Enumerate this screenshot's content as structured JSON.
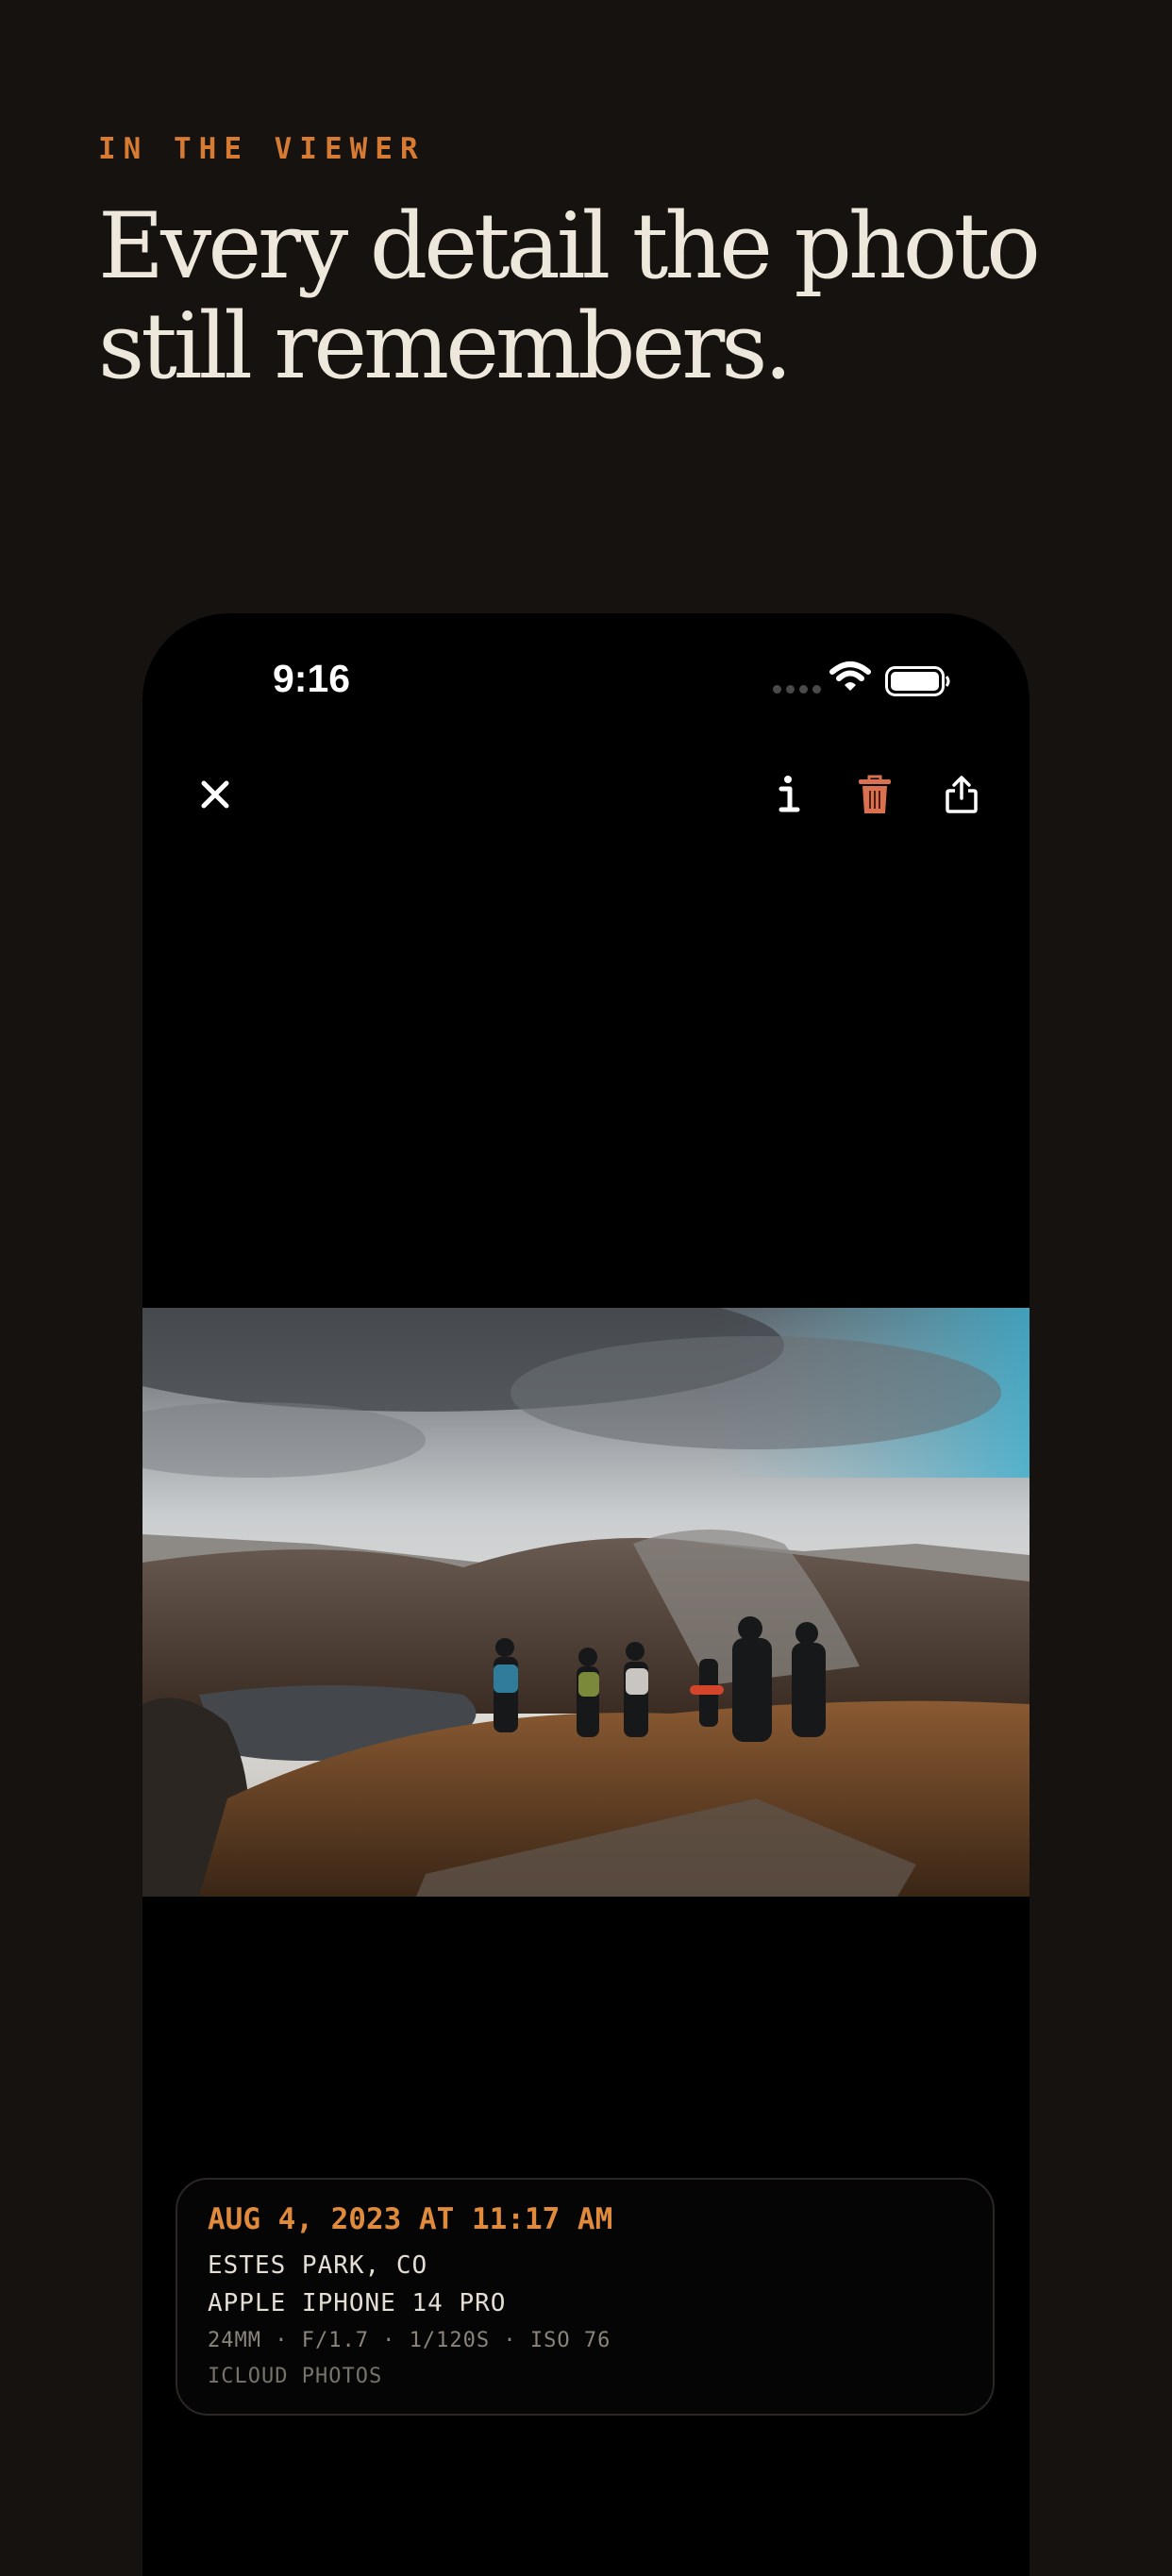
{
  "section": {
    "eyebrow": "IN THE VIEWER",
    "headline_line1": "Every detail the photo",
    "headline_line2": "still remembers."
  },
  "status_bar": {
    "time": "9:16"
  },
  "toolbar": {
    "close_icon": "close-icon",
    "info_icon": "info-icon",
    "delete_icon": "trash-icon",
    "share_icon": "share-icon",
    "delete_color": "#d9704f"
  },
  "photo_info": {
    "date": "AUG 4, 2023 AT 11:17 AM",
    "location": "ESTES PARK, CO",
    "camera": "APPLE IPHONE 14 PRO",
    "exif": "24MM · F/1.7 · 1/120S · ISO 76",
    "source": "ICLOUD PHOTOS"
  },
  "colors": {
    "background": "#15120f",
    "accent": "#d77a32",
    "phone": "#000000"
  }
}
